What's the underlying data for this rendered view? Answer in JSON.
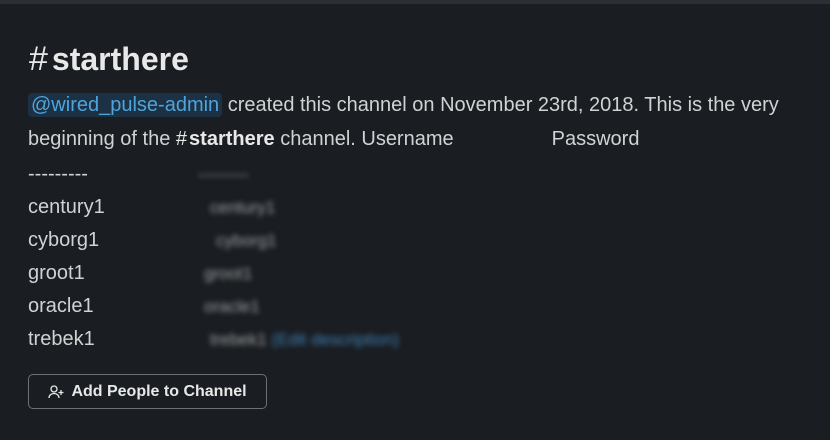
{
  "channel": {
    "hash": "#",
    "name": "starthere"
  },
  "intro": {
    "mention": "@wired_pulse-admin",
    "text_before": " created this channel on November 23rd, 2018. This is the very beginning of the ",
    "inline_hash": "#",
    "inline_channel": "starthere",
    "text_after": " channel. Username",
    "password_header": "Password"
  },
  "table": {
    "user_divider": "---------",
    "pw_divider": "---------",
    "rows": [
      {
        "username": "century1",
        "password": "century1"
      },
      {
        "username": "cyborg1",
        "password": "cyborg1"
      },
      {
        "username": "groot1",
        "password": "groot1"
      },
      {
        "username": "oracle1",
        "password": "oracle1"
      },
      {
        "username": "trebek1",
        "password": "trebek1",
        "edit_link": "(Edit description)"
      }
    ]
  },
  "actions": {
    "add_people_label": "Add People to Channel",
    "add_people_icon": "add-user-icon"
  },
  "colors": {
    "background": "#1a1d21",
    "text": "#d1d2d3",
    "mention_bg": "#1d3144",
    "mention_text": "#4ea4dc",
    "button_border": "#6f7073"
  }
}
